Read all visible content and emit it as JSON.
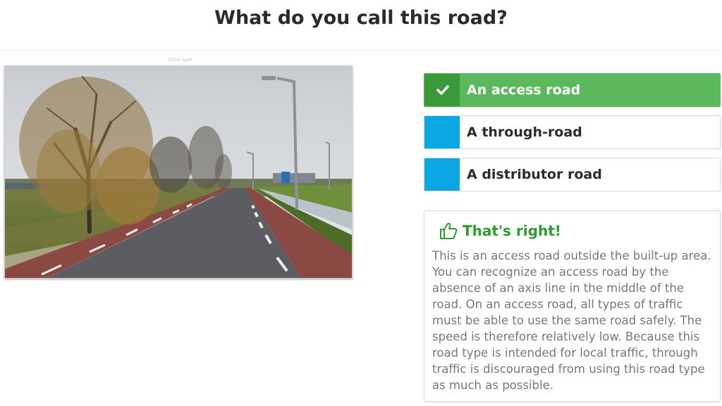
{
  "question": {
    "title": "What do you call this road?"
  },
  "image": {
    "caption": "27/04 3p04"
  },
  "answers": [
    {
      "label": "An access road",
      "state": "correct"
    },
    {
      "label": "A through-road",
      "state": "unselected"
    },
    {
      "label": "A distributor road",
      "state": "unselected"
    }
  ],
  "feedback": {
    "icon": "thumbs-up-icon",
    "title": "That's right!",
    "text": "This is an access road outside the built-up area. You can recognize an access road by the absence of an axis line in the middle of the road. On an access road, all types of traffic must be able to use the same road safely. The speed is therefore relatively low. Because this road type is intended for local traffic, through traffic is discouraged from using this road type as much as possible."
  },
  "colors": {
    "correct_green": "#5cb85c",
    "correct_green_dark": "#3a9a3a",
    "marker_blue": "#0aa7e3",
    "feedback_title_green": "#2e9b2e"
  }
}
